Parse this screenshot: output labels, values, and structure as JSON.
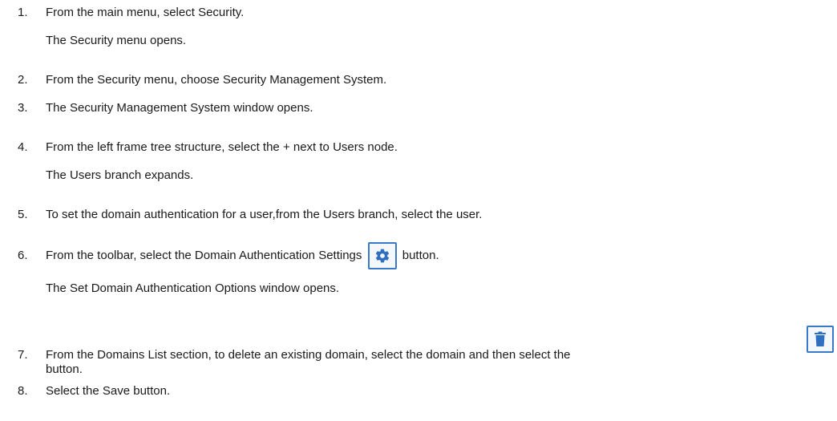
{
  "steps": [
    {
      "num": "1.",
      "text": "From the main menu, select Security.",
      "result": "The Security menu opens."
    },
    {
      "num": "2.",
      "text": "From the Security menu, choose Security Management System."
    },
    {
      "num": "3.",
      "text": "The Security Management System window opens."
    },
    {
      "num": "4.",
      "text": "From the left frame tree structure, select the + next to Users node.",
      "result": "The Users branch expands."
    },
    {
      "num": "5.",
      "text": "To set the domain authentication for a user,from the Users branch, select the user."
    },
    {
      "num": "6.",
      "text_before": "From the toolbar, select the Domain Authentication Settings",
      "text_after": "button.",
      "result": "The Set Domain Authentication Options window opens."
    },
    {
      "num": "7.",
      "text": "From the Domains List section, to delete an existing  domain, select the domain and then select the",
      "continuation": "button."
    },
    {
      "num": "8.",
      "text": "Select the Save button."
    }
  ],
  "icons": {
    "settings": "gear-icon",
    "delete": "trash-icon",
    "accent_color": "#3a78c8",
    "icon_color": "#2f6fbf"
  }
}
